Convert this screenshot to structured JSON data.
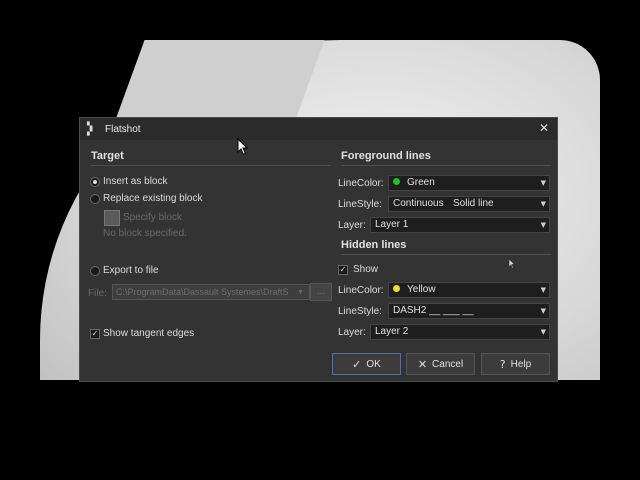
{
  "dialog": {
    "title": "Flatshot",
    "close_symbol": "✕"
  },
  "target": {
    "heading": "Target",
    "insert_as_block": "Insert as block",
    "replace_existing_block": "Replace existing block",
    "specify_block": "Specify block",
    "no_block_specified": "No block specified.",
    "export_to_file": "Export to file",
    "file_label": "File:",
    "file_value": "C:\\ProgramData\\Dassault Systemes\\DraftS",
    "browse_label": "...",
    "show_tangent_edges": "Show tangent edges"
  },
  "foreground": {
    "heading": "Foreground lines",
    "linecolor_label": "LineColor:",
    "linecolor_value": "Green",
    "linecolor_hex": "#22c022",
    "linestyle_label": "LineStyle:",
    "linestyle_value": "Continuous",
    "linestyle_desc": "Solid line",
    "layer_label": "Layer:",
    "layer_value": "Layer 1"
  },
  "hidden": {
    "heading": "Hidden lines",
    "show_label": "Show",
    "linecolor_label": "LineColor:",
    "linecolor_value": "Yellow",
    "linecolor_hex": "#f0e020",
    "linestyle_label": "LineStyle:",
    "linestyle_value": "DASH2 __ ___ __",
    "layer_label": "Layer:",
    "layer_value": "Layer 2"
  },
  "buttons": {
    "ok": "OK",
    "cancel": "Cancel",
    "help": "Help"
  },
  "icons": {
    "check": "✓",
    "cancel_x": "✕",
    "help_q": "?",
    "dropdown": "▼",
    "app": "flatshot-app-icon"
  }
}
